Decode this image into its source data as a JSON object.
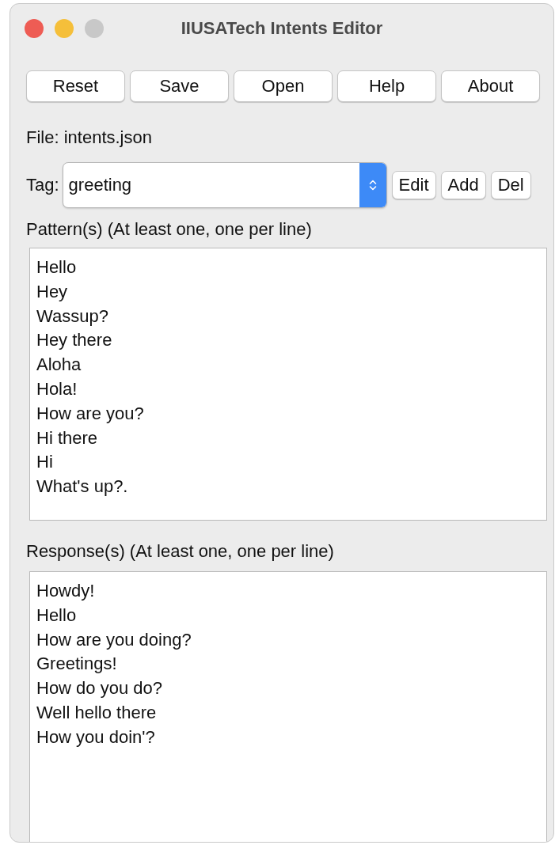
{
  "window": {
    "title": "IIUSATech Intents Editor"
  },
  "buttons": [
    "Reset",
    "Save",
    "Open",
    "Help",
    "About"
  ],
  "file_label": "File: intents.json",
  "tag": {
    "label": "Tag:",
    "value": "greeting",
    "buttons": [
      "Edit",
      "Add",
      "Del"
    ]
  },
  "patterns": {
    "label": "Pattern(s) (At least one, one per line)",
    "lines": [
      "Hello",
      "Hey",
      "Wassup?",
      "Hey there",
      "Aloha",
      "Hola!",
      "How are you?",
      "Hi there",
      "Hi",
      "What's up?."
    ]
  },
  "responses": {
    "label": "Response(s) (At least one, one per line)",
    "lines": [
      "Howdy!",
      "Hello",
      "How are you doing?",
      "Greetings!",
      "How do you do?",
      "Well hello there",
      "How you doin'?"
    ]
  }
}
